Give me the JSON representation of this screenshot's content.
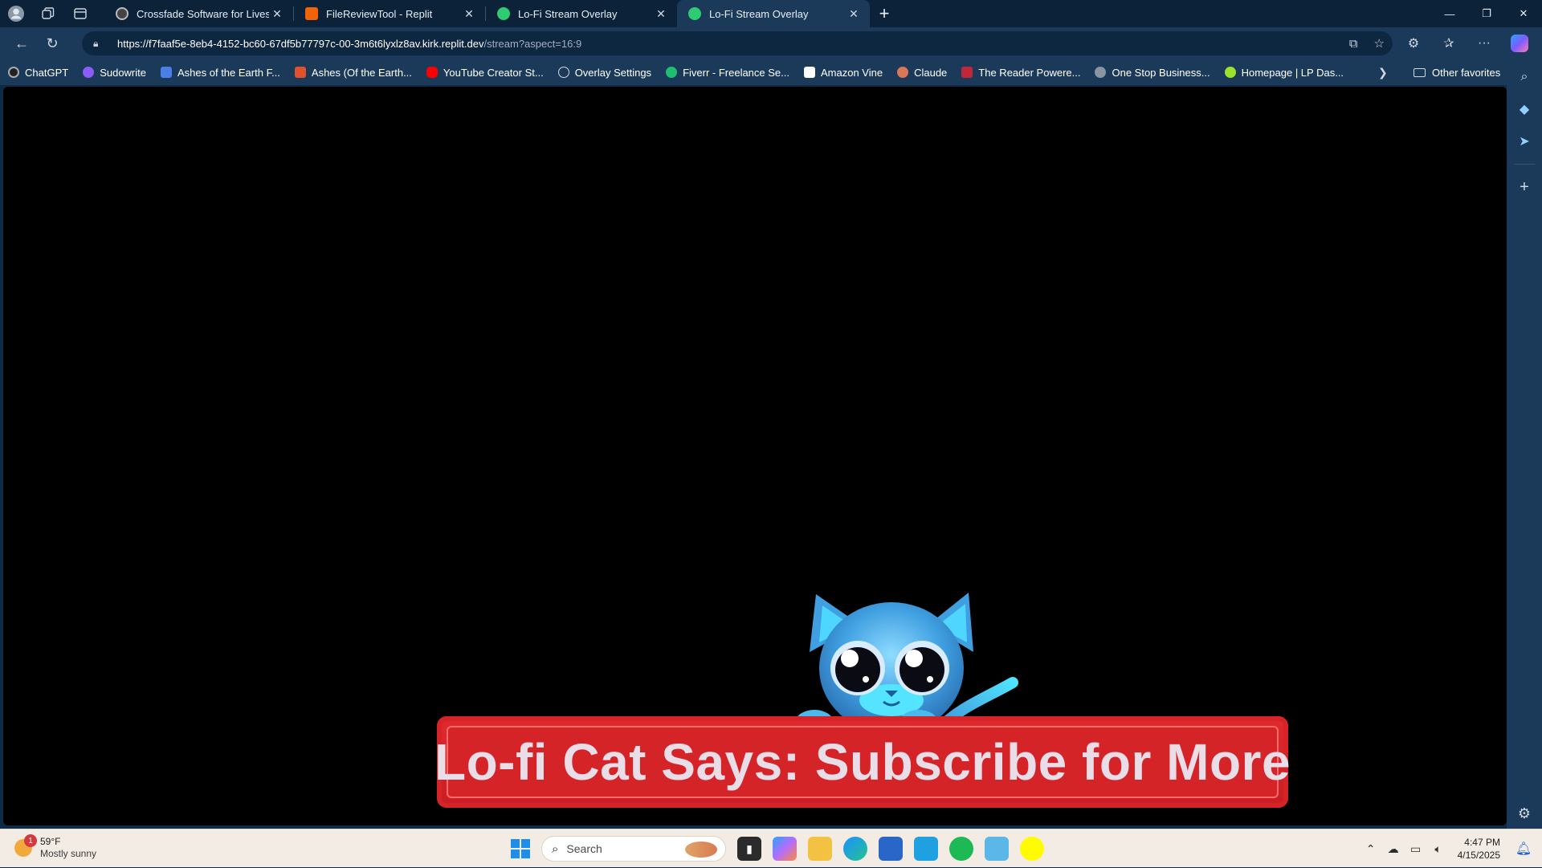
{
  "browser": {
    "tabs": [
      {
        "title": "Crossfade Software for Livestream",
        "favicon_color": "#444444"
      },
      {
        "title": "FileReviewTool - Replit",
        "favicon_color": "#f26207"
      },
      {
        "title": "Lo-Fi Stream Overlay",
        "favicon_color": "#2ecc71"
      },
      {
        "title": "Lo-Fi Stream Overlay",
        "favicon_color": "#2ecc71"
      }
    ],
    "url_host": "https://f7faaf5e-8eb4-4152-bc60-67df5b77797c-00-3m6t6lyxlz8av.kirk.replit.dev",
    "url_path": "/stream?aspect=16:9"
  },
  "favorites": [
    {
      "label": "ChatGPT",
      "color": "#222222"
    },
    {
      "label": "Sudowrite",
      "color": "#8b5cf6"
    },
    {
      "label": "Ashes of the Earth F...",
      "color": "#4a7fe6"
    },
    {
      "label": "Ashes (Of the Earth...",
      "color": "#e0522b"
    },
    {
      "label": "YouTube Creator St...",
      "color": "#ff0000"
    },
    {
      "label": "Overlay Settings",
      "color": "#9aa7b4"
    },
    {
      "label": "Fiverr - Freelance Se...",
      "color": "#1dbf73"
    },
    {
      "label": "Amazon Vine",
      "color": "#ffffff"
    },
    {
      "label": "Claude",
      "color": "#d97757"
    },
    {
      "label": "The Reader Powere...",
      "color": "#c0283a"
    },
    {
      "label": "One Stop Business...",
      "color": "#8a95a3"
    },
    {
      "label": "Homepage | LP Das...",
      "color": "#9be22d"
    }
  ],
  "other_favorites_label": "Other favorites",
  "overlay": {
    "banner_text": "Lo-fi Cat Says: Subscribe for More",
    "banner_color": "#d52428"
  },
  "taskbar": {
    "weather_temp": "59°F",
    "weather_condition": "Mostly sunny",
    "weather_badge": "1",
    "search_placeholder": "Search",
    "time": "4:47 PM",
    "date": "4/15/2025"
  }
}
